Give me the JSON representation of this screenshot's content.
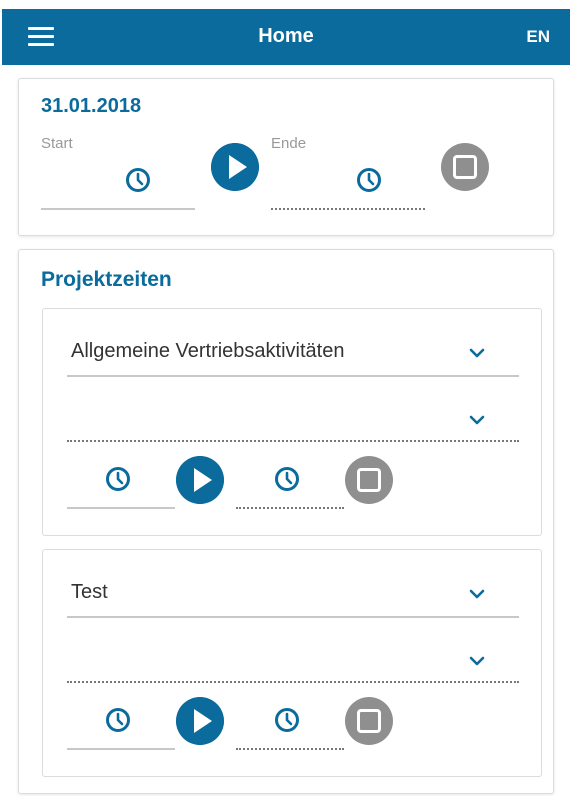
{
  "appbar": {
    "title": "Home",
    "lang": "EN",
    "menu_icon": "hamburger-menu-icon"
  },
  "day": {
    "date": "31.01.2018",
    "start_label": "Start",
    "end_label": "Ende"
  },
  "projects": {
    "title": "Projektzeiten",
    "items": [
      {
        "project": "Allgemeine Vertriebsaktivitäten",
        "task": ""
      },
      {
        "project": "Test",
        "task": ""
      }
    ]
  },
  "colors": {
    "primary": "#0a6b9c",
    "stop": "#8f8f8f"
  }
}
